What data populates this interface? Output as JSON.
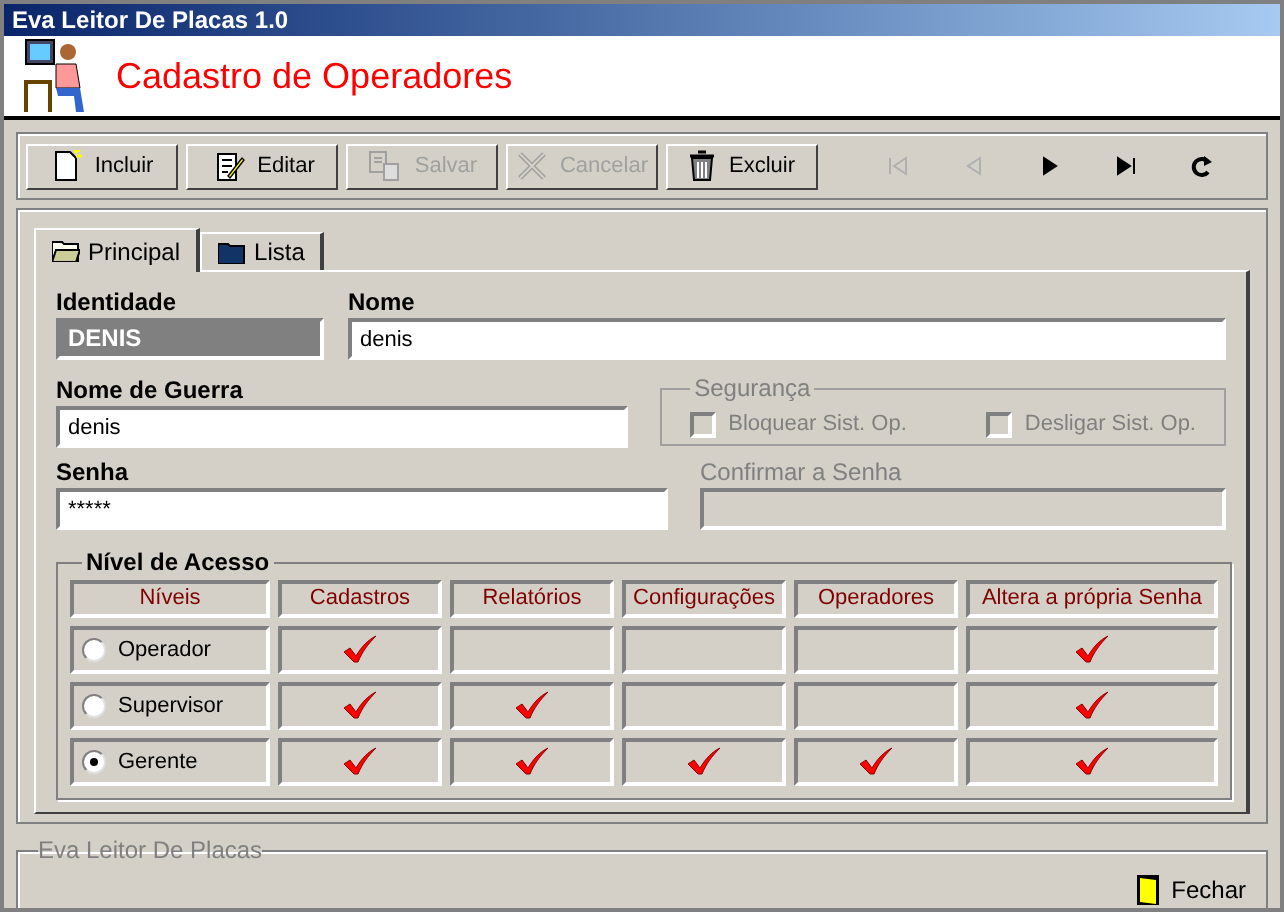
{
  "window": {
    "title": "Eva Leitor De Placas 1.0"
  },
  "header": {
    "title": "Cadastro de Operadores"
  },
  "toolbar": [
    {
      "kind": "new",
      "label": "Incluir",
      "disabled": false
    },
    {
      "kind": "edit",
      "label": "Editar",
      "disabled": false
    },
    {
      "kind": "save",
      "label": "Salvar",
      "disabled": true
    },
    {
      "kind": "cancel",
      "label": "Cancelar",
      "disabled": true
    },
    {
      "kind": "delete",
      "label": "Excluir",
      "disabled": false
    }
  ],
  "navigation": [
    {
      "kind": "first",
      "disabled": true
    },
    {
      "kind": "prev",
      "disabled": true
    },
    {
      "kind": "next",
      "disabled": false
    },
    {
      "kind": "last",
      "disabled": false
    },
    {
      "kind": "refresh",
      "disabled": false
    }
  ],
  "tabs": [
    {
      "label": "Principal",
      "selected": true
    },
    {
      "label": "Lista",
      "selected": false
    }
  ],
  "form": {
    "identity": {
      "label": "Identidade",
      "value": "DENIS"
    },
    "name": {
      "label": "Nome",
      "value": "denis"
    },
    "nickname": {
      "label": "Nome de Guerra",
      "value": "denis"
    },
    "password": {
      "label": "Senha",
      "value": "*****"
    },
    "confirm_password": {
      "label": "Confirmar a Senha",
      "disabled": true
    }
  },
  "security": {
    "title": "Segurança",
    "options": [
      {
        "label": "Bloquear Sist. Op.",
        "checked": false,
        "disabled": true
      },
      {
        "label": "Desligar Sist. Op.",
        "checked": false,
        "disabled": true
      }
    ]
  },
  "access": {
    "title": "Nível de Acesso",
    "columns": [
      "Níveis",
      "Cadastros",
      "Relatórios",
      "Configurações",
      "Operadores",
      "Altera a própria Senha"
    ],
    "rows": [
      {
        "label": "Operador",
        "selected": false,
        "permissions": [
          true,
          false,
          false,
          false,
          true
        ]
      },
      {
        "label": "Supervisor",
        "selected": false,
        "permissions": [
          true,
          true,
          false,
          false,
          true
        ]
      },
      {
        "label": "Gerente",
        "selected": true,
        "permissions": [
          true,
          true,
          true,
          true,
          true
        ]
      }
    ]
  },
  "footer": {
    "group_label": "Eva Leitor De Placas",
    "close_button": "Fechar"
  }
}
